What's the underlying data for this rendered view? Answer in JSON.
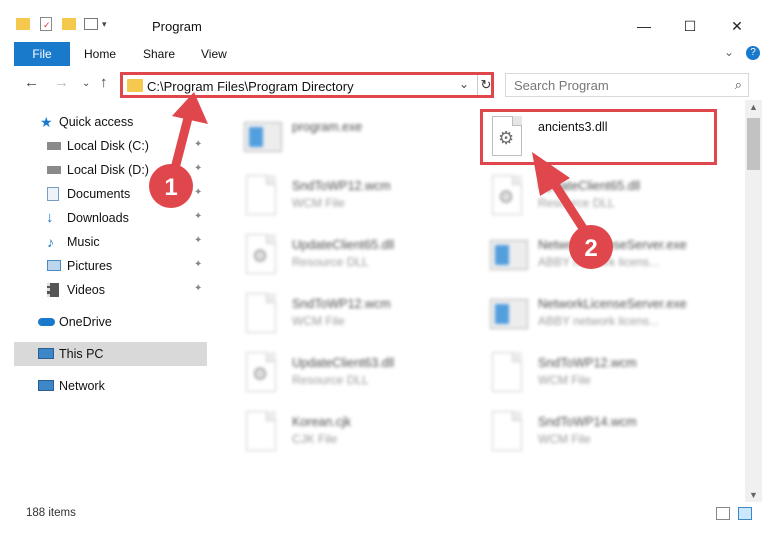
{
  "window": {
    "title": "Program",
    "minimize": "—",
    "maximize": "☐",
    "close": "✕"
  },
  "ribbon": {
    "tabs": [
      "File",
      "Home",
      "Share",
      "View"
    ],
    "expand": "⌄",
    "help": "?"
  },
  "nav": {
    "back": "←",
    "forward": "→",
    "recent": "⌄",
    "up": "↑",
    "address": "C:\\Program Files\\Program Directory",
    "address_chevron": "⌄",
    "refresh": "↻",
    "search_placeholder": "Search Program",
    "search_icon": "⌕"
  },
  "sidebar": {
    "items": [
      {
        "label": "Quick access",
        "icon": "star-icon",
        "color": "#1979ca",
        "pinned": false
      },
      {
        "label": "Local Disk (C:)",
        "icon": "drive-icon",
        "color": "#6b6b6b",
        "pinned": true
      },
      {
        "label": "Local Disk (D:)",
        "icon": "drive-icon",
        "color": "#6b6b6b",
        "pinned": true
      },
      {
        "label": "Documents",
        "icon": "documents-icon",
        "color": "#7a9cc4",
        "pinned": true
      },
      {
        "label": "Downloads",
        "icon": "download-icon",
        "color": "#1979ca",
        "pinned": true
      },
      {
        "label": "Music",
        "icon": "music-icon",
        "color": "#1979ca",
        "pinned": true
      },
      {
        "label": "Pictures",
        "icon": "pictures-icon",
        "color": "#4a8ac4",
        "pinned": true
      },
      {
        "label": "Videos",
        "icon": "videos-icon",
        "color": "#555555",
        "pinned": true
      },
      {
        "label": "OneDrive",
        "icon": "cloud-icon",
        "color": "#1979ca",
        "pinned": false
      },
      {
        "label": "This PC",
        "icon": "computer-icon",
        "color": "#3d86c8",
        "pinned": false,
        "selected": true
      },
      {
        "label": "Network",
        "icon": "network-icon",
        "color": "#3d86c8",
        "pinned": false
      }
    ],
    "pin_glyph": "📌"
  },
  "files": [
    {
      "name": "program.exe",
      "type": "",
      "icon": "exe-icon",
      "blurred": true
    },
    {
      "name": "ancients3.dll",
      "type": "",
      "icon": "dll-gear-icon",
      "blurred": false
    },
    {
      "name": "SndToWP12.wcm",
      "type": "WCM File",
      "icon": "document-icon",
      "blurred": true
    },
    {
      "name": "UpdateClient65.dll",
      "type": "Resource DLL",
      "icon": "dll-gear-icon",
      "blurred": true
    },
    {
      "name": "UpdateClient65.dll",
      "type": "Resource DLL",
      "icon": "dll-gear-icon",
      "blurred": true
    },
    {
      "name": "NetworkLicenseServer.exe",
      "type": "ABBY network licens...",
      "icon": "app-icon",
      "blurred": true
    },
    {
      "name": "SndToWP12.wcm",
      "type": "WCM File",
      "icon": "document-icon",
      "blurred": true
    },
    {
      "name": "NetworkLicenseServer.exe",
      "type": "ABBY network licens...",
      "icon": "app-icon",
      "blurred": true
    },
    {
      "name": "UpdateClient63.dll",
      "type": "Resource DLL",
      "icon": "dll-gear-icon",
      "blurred": true
    },
    {
      "name": "SndToWP12.wcm",
      "type": "WCM File",
      "icon": "document-icon",
      "blurred": true
    },
    {
      "name": "Korean.cjk",
      "type": "CJK File",
      "icon": "document-icon",
      "blurred": true
    },
    {
      "name": "SndToWP14.wcm",
      "type": "WCM File",
      "icon": "document-icon",
      "blurred": true
    }
  ],
  "annotations": {
    "badge_1": "1",
    "badge_2": "2",
    "color": "#e0474c"
  },
  "status": {
    "item_count": "188 items"
  }
}
